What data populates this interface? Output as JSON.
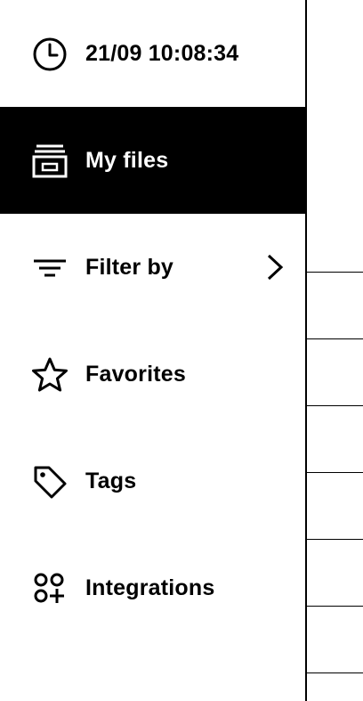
{
  "sidebar": {
    "items": [
      {
        "id": "clock",
        "label": "21/09 10:08:34",
        "icon": "clock-icon",
        "active": false
      },
      {
        "id": "my-files",
        "label": "My files",
        "icon": "files-icon",
        "active": true
      },
      {
        "id": "filter-by",
        "label": "Filter by",
        "icon": "filter-icon",
        "active": false,
        "has_submenu": true
      },
      {
        "id": "favorites",
        "label": "Favorites",
        "icon": "star-icon",
        "active": false
      },
      {
        "id": "tags",
        "label": "Tags",
        "icon": "tag-icon",
        "active": false
      },
      {
        "id": "integrations",
        "label": "Integrations",
        "icon": "integrations-icon",
        "active": false
      }
    ]
  },
  "colors": {
    "active_background": "#000000",
    "active_text": "#ffffff",
    "text": "#000000",
    "background": "#ffffff"
  }
}
